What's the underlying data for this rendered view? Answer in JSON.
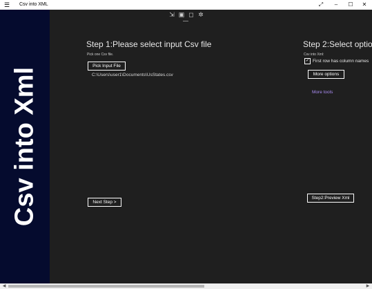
{
  "window": {
    "title": "Csv into XML",
    "app_icon": "☰",
    "controls": {
      "fullscreen": "⤢",
      "minimize": "–",
      "maximize": "☐",
      "close": "✕"
    }
  },
  "sidebar": {
    "vertical_title": "Csv into Xml",
    "bg_color": "#050b2e"
  },
  "toolbar": {
    "icons": [
      "export-icon",
      "chat-icon",
      "frame-icon",
      "bug-icon"
    ]
  },
  "step1": {
    "heading": "Step 1:Please select input Csv file",
    "hint": "Pick one Csv file.",
    "pick_button": "Pick Input File",
    "file_path": "C:\\Users\\user1\\Documents\\UsStates.csv",
    "next_button": "Next Step >"
  },
  "step2": {
    "heading": "Step 2:Select optio",
    "subtitle": "Csv into Xml:",
    "first_row_label": "First row has column names",
    "first_row_checked": true,
    "more_options_button": "More options",
    "more_tools_link": "More tools",
    "preview_button": "Step2:Preview Xml"
  },
  "colors": {
    "accent_link": "#a98cf2",
    "background": "#1f1f1f"
  }
}
